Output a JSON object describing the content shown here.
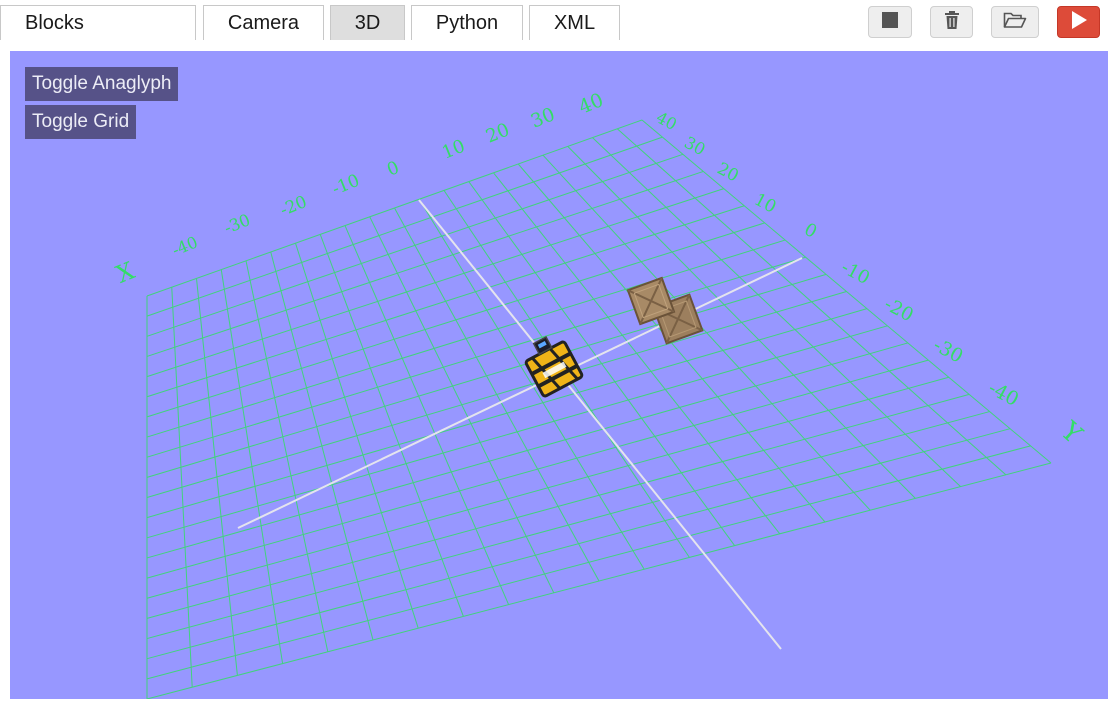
{
  "tabs": [
    {
      "label": "Blocks"
    },
    {
      "label": "Camera"
    },
    {
      "label": "3D"
    },
    {
      "label": "Python"
    },
    {
      "label": "XML"
    }
  ],
  "active_tab": "3D",
  "toolbar_icons": [
    "stop-icon",
    "trash-icon",
    "folder-open-icon",
    "play-icon"
  ],
  "overlay": {
    "anaglyph_label": "Toggle Anaglyph",
    "grid_label": "Toggle Grid"
  },
  "scene": {
    "x_axis_label": "X",
    "y_axis_label": "Y",
    "x_ticks": [
      "-40",
      "-30",
      "-20",
      "-10",
      "0",
      "10",
      "20",
      "30",
      "40"
    ],
    "y_ticks": [
      "40",
      "30",
      "20",
      "10",
      "0",
      "-10",
      "-20",
      "-30",
      "-40"
    ]
  },
  "colors": {
    "viewport_bg": "#9797ff",
    "grid": "#33dd66",
    "axis_line": "#e0e0e8",
    "run_button": "#dd4b39",
    "overlay_button": "#565288"
  }
}
